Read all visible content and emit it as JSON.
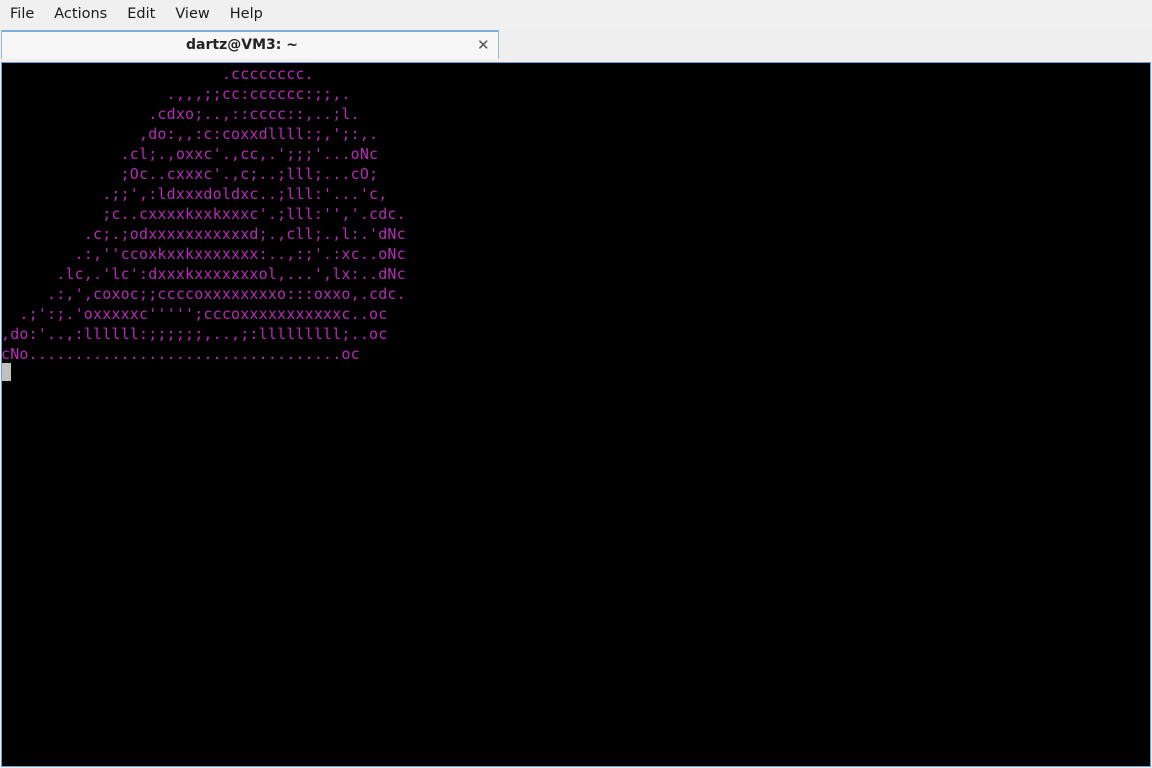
{
  "menubar": {
    "items": [
      "File",
      "Actions",
      "Edit",
      "View",
      "Help"
    ]
  },
  "tab": {
    "title": "dartz@VM3: ~",
    "close_glyph": "✕"
  },
  "terminal": {
    "ascii_color": "#b52bb5",
    "background": "#000000",
    "lines": [
      "                        .cccccccc.",
      "                  .,,,;;cc:cccccc:;;,.",
      "                .cdxo;..,::cccc::,..;l.",
      "               ,do:,,:c:coxxdllll:;,';:,.",
      "             .cl;.,oxxc'.,cc,.';;;'...oNc",
      "             ;Oc..cxxxc'.,c;..;lll;...cO;",
      "           .;;',:ldxxxdoldxc..;lll:'...'c,",
      "           ;c..cxxxxkxxkxxxc'.;lll:'','.cdc.",
      "         .c;.;odxxxxxxxxxxxd;.,cll;.,l:.'dNc",
      "        .:,''ccoxkxxkxxxxxxx:..,:;'.:xc..oNc",
      "      .lc,.'lc':dxxxkxxxxxxxol,...',lx:..dNc",
      "     .:,',coxoc;;ccccoxxxxxxxxo:::oxxo,.cdc.",
      "  .;':;.'oxxxxxc''''';cccoxxxxxxxxxxxc..oc",
      ",do:'..,:llllll:;;;;;;,..,;:lllllllll;..oc",
      "cNo..................................oc"
    ]
  }
}
